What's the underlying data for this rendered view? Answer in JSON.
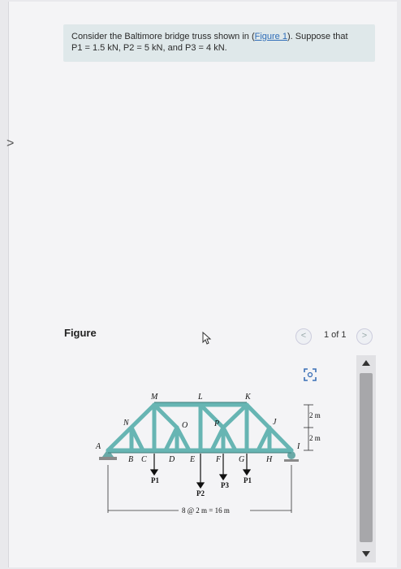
{
  "nav": {
    "left_arrow": ">"
  },
  "question": {
    "line1_prefix": "Consider the Baltimore bridge truss shown in (",
    "line1_link": "Figure 1",
    "line1_suffix": "). Suppose that",
    "line2": "P1 = 1.5 kN, P2 = 5 kN, and P3 = 4 kN."
  },
  "figure": {
    "label": "Figure",
    "pager": {
      "prev": "<",
      "text": "1 of 1",
      "next": ">"
    },
    "icons": [
      "cursor-icon",
      "expand-icon"
    ],
    "truss_labels": {
      "top": [
        "M",
        "L",
        "K"
      ],
      "upper": [
        "N",
        "O",
        "P",
        "J"
      ],
      "bottom": [
        "A",
        "B",
        "C",
        "D",
        "E",
        "F",
        "G",
        "H",
        "I"
      ],
      "loads": [
        "P1",
        "P2",
        "P3",
        "P1"
      ],
      "dim_height1": "2 m",
      "dim_height2": "2 m",
      "span": "8 @ 2 m = 16 m"
    }
  },
  "scrollbar": {
    "up": "▲",
    "down": "▼"
  }
}
